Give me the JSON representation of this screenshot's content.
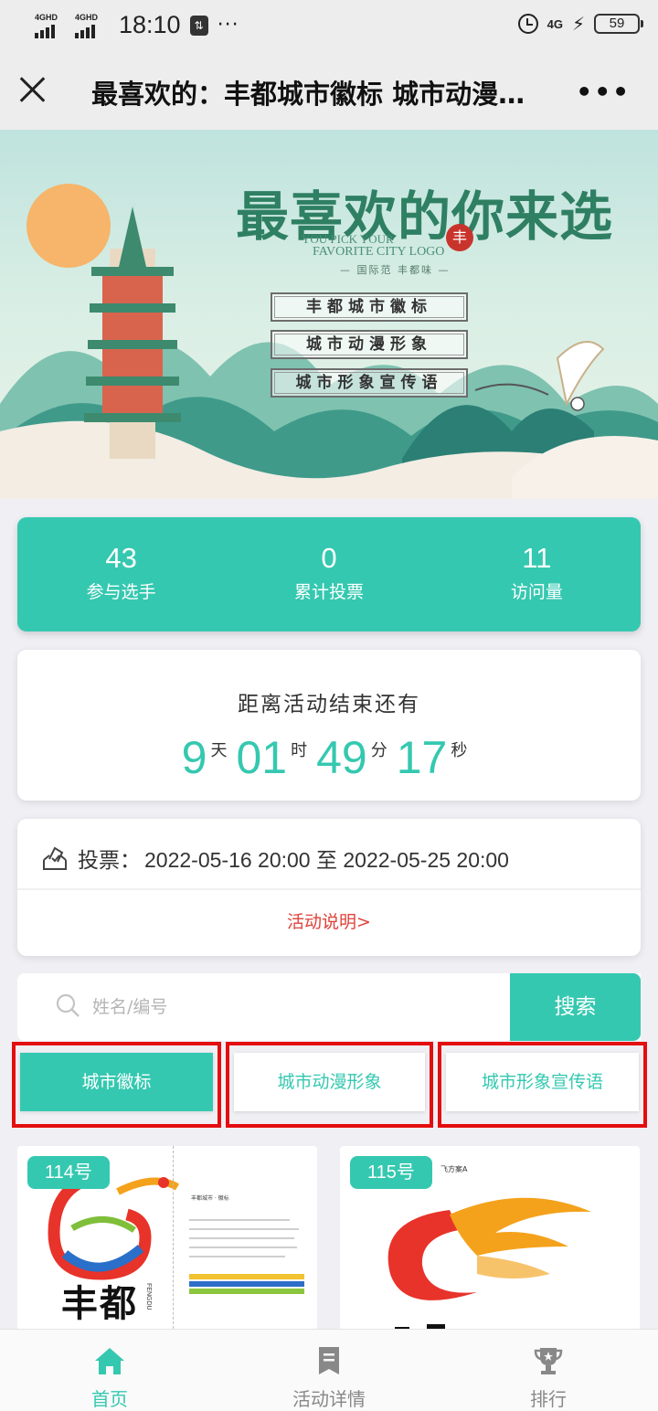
{
  "status_bar": {
    "signal1_label": "4GHD",
    "signal2_label": "4GHD",
    "time": "18:10",
    "usb_icon_text": "⇅",
    "more_dots": "···",
    "network_label": "4G",
    "battery_level": "59"
  },
  "title_bar": {
    "title": "最喜欢的：丰都城市徽标 城市动漫…",
    "more_label": "•••"
  },
  "banner": {
    "title": "最喜欢的你来选",
    "seal_text": "丰",
    "subtitle_en_1": "YOU PICK YOUR",
    "subtitle_en_2": "FAVORITE CITY LOGO",
    "subtitle_cn": "— 国际范  丰都味 —",
    "categories": [
      "丰都城市徽标",
      "城市动漫形象",
      "城市形象宣传语"
    ]
  },
  "stats": [
    {
      "value": "43",
      "label": "参与选手"
    },
    {
      "value": "0",
      "label": "累计投票"
    },
    {
      "value": "11",
      "label": "访问量"
    }
  ],
  "countdown": {
    "title": "距离活动结束还有",
    "days": "9",
    "days_unit": "天",
    "hours": "01",
    "hours_unit": "时",
    "minutes": "49",
    "minutes_unit": "分",
    "seconds": "17",
    "seconds_unit": "秒"
  },
  "vote_period": {
    "label": "投票：",
    "value": "2022-05-16 20:00 至 2022-05-25 20:00",
    "rules_link": "活动说明>"
  },
  "search": {
    "placeholder": "姓名/编号",
    "button_label": "搜索"
  },
  "tabs": [
    {
      "label": "城市徽标",
      "active": true
    },
    {
      "label": "城市动漫形象",
      "active": false
    },
    {
      "label": "城市形象宣传语",
      "active": false
    }
  ],
  "entries": [
    {
      "badge": "114号",
      "logo_text": "丰都",
      "logo_en": "FENGDU"
    },
    {
      "badge": "115号",
      "top_text": "飞方案A"
    }
  ],
  "bottom_nav": [
    {
      "label": "首页",
      "icon": "home-icon",
      "active": true
    },
    {
      "label": "活动详情",
      "icon": "document-icon",
      "active": false
    },
    {
      "label": "排行",
      "icon": "trophy-icon",
      "active": false
    }
  ],
  "colors": {
    "accent": "#35c8b0",
    "highlight_border": "#e40e0e",
    "link": "#e0413a"
  }
}
